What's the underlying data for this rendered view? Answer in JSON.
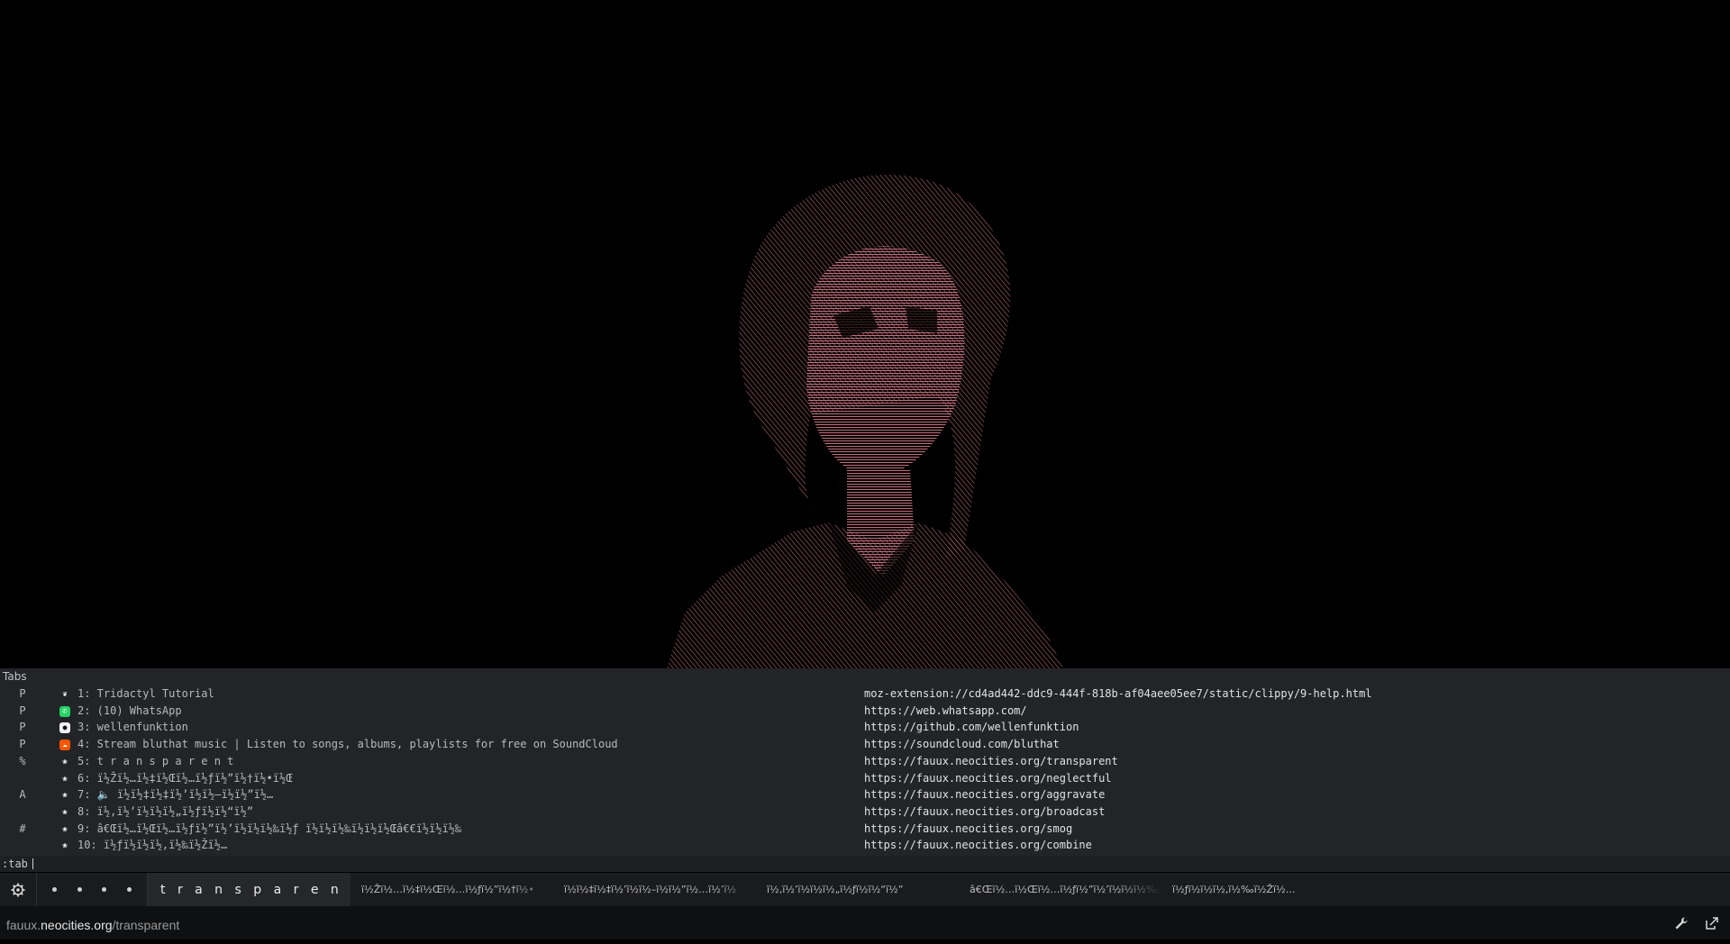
{
  "completion": {
    "header": "Tabs",
    "rows": [
      {
        "prefix": "P",
        "favicon": "tridactyl-leaf-icon",
        "title": "1: Tridactyl Tutorial",
        "url": "moz-extension://cd4ad442-ddc9-444f-818b-af04aee05ee7/static/clippy/9-help.html"
      },
      {
        "prefix": "P",
        "favicon": "whatsapp-icon",
        "title": "2: (10) WhatsApp",
        "url": "https://web.whatsapp.com/"
      },
      {
        "prefix": "P",
        "favicon": "github-icon",
        "title": "3: wellenfunktion",
        "url": "https://github.com/wellenfunktion"
      },
      {
        "prefix": "P",
        "favicon": "soundcloud-icon",
        "title": "4: Stream bluthat music | Listen to songs, albums, playlists for free on SoundCloud",
        "url": "https://soundcloud.com/bluthat"
      },
      {
        "prefix": "%",
        "favicon": "neocities-icon",
        "title": "5: t r a n s p a r e n t",
        "url": "https://fauux.neocities.org/transparent"
      },
      {
        "prefix": "",
        "favicon": "neocities-icon",
        "title": "6: ï½Žï½…ï½‡ï½Œï½…ï½ƒï½”ï½†ï½•ï½Œ",
        "url": "https://fauux.neocities.org/neglectful"
      },
      {
        "prefix": "A",
        "favicon": "neocities-icon",
        "speaker": "🔈",
        "title": "7: ï½ï½‡ï½‡ï½’ï½ï½–ï½ï½”ï½…",
        "url": "https://fauux.neocities.org/aggravate"
      },
      {
        "prefix": "",
        "favicon": "neocities-icon",
        "title": "8: ï½‚ï½’ï½ï½ï½„ï½ƒï½ï½“ï½”",
        "url": "https://fauux.neocities.org/broadcast"
      },
      {
        "prefix": "#",
        "favicon": "neocities-icon",
        "title": "9: â€Œï½…ï½Œï½…ï½ƒï½”ï½’ï½ï½ï½‰ï½ƒ ï½ï½ï½‰ï½ï½ï½Œâ€€ï½ï½ï½‰",
        "url": "https://fauux.neocities.org/smog"
      },
      {
        "prefix": "",
        "favicon": "neocities-icon",
        "title": "10: ï½ƒï½ï½ï½‚ï½‰ï½Žï½…",
        "url": "https://fauux.neocities.org/combine"
      }
    ]
  },
  "cmdline": {
    "value": ":tab "
  },
  "tabstrip": {
    "pinned_count": 4,
    "active_tab": "t r a n s p a r e n t",
    "tabs": [
      "ï½Žï½…ï½‡ï½Œï½…ï½ƒï½”ï½†ï½•",
      "ï½ï½‡ï½‡ï½’ï½ï½–ï½ï½”ï½…ï½’ï½",
      "ï½‚ï½’ï½ï½ï½„ï½ƒï½ï½“ï½”",
      "â€Œï½…ï½Œï½…ï½ƒï½”ï½’ï½ï½ï½‰ï½ƒ",
      "ï½ƒï½ï½ï½‚ï½‰ï½Žï½…"
    ]
  },
  "statusbar": {
    "url_sub": "fauux.",
    "url_domain": "neocities.org",
    "url_path": "/transparent"
  },
  "colors": {
    "portrait": "#c2707a",
    "panel_bg": "#222428",
    "tabstrip_bg": "#1a1b1e",
    "statusbar_bg": "#0f1012"
  }
}
